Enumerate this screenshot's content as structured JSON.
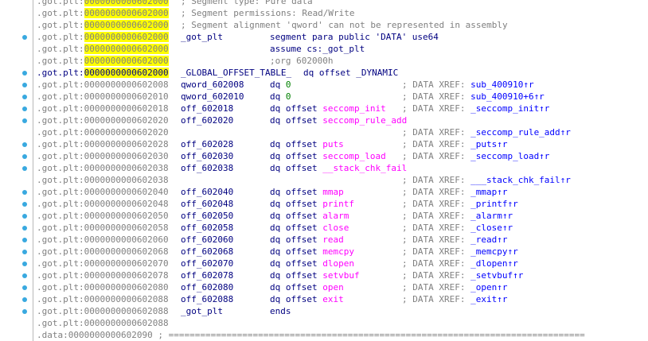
{
  "segments": {
    "got_plt": ".got.plt:",
    "data": ".data:"
  },
  "lines": [
    {
      "addr": "0000000000602000",
      "seg": "got_plt",
      "hl": true,
      "comment": "; Segment type: Pure data"
    },
    {
      "addr": "0000000000602000",
      "seg": "got_plt",
      "hl": true,
      "comment": "; Segment permissions: Read/Write"
    },
    {
      "addr": "0000000000602000",
      "seg": "got_plt",
      "hl": true,
      "comment": "; Segment alignment 'qword' can not be represented in assembly"
    },
    {
      "addr": "0000000000602000",
      "seg": "got_plt",
      "hl": true,
      "label": "_got_plt",
      "op": "segment para public 'DATA' use64"
    },
    {
      "addr": "0000000000602000",
      "seg": "got_plt",
      "hl": true,
      "op": "assume cs:_got_plt"
    },
    {
      "addr": "0000000000602000",
      "seg": "got_plt",
      "hl": true,
      "op": ";org 602000h",
      "op_comment": true
    },
    {
      "addr": "0000000000602000",
      "seg": "got_plt",
      "hl": true,
      "current": true,
      "label": "_GLOBAL_OFFSET_TABLE_",
      "op_inline": "dq offset _DYNAMIC"
    },
    {
      "addr": "0000000000602008",
      "seg": "got_plt",
      "label": "qword_602008",
      "kw": "dq",
      "num": "0",
      "xref_prefix": "; DATA XREF: ",
      "xref": "sub_400910↑r"
    },
    {
      "addr": "0000000000602010",
      "seg": "got_plt",
      "label": "qword_602010",
      "kw": "dq",
      "num": "0",
      "xref_prefix": "; DATA XREF: ",
      "xref": "sub_400910+6↑r"
    },
    {
      "addr": "0000000000602018",
      "seg": "got_plt",
      "label": "off_602018",
      "kw": "dq offset",
      "imp": "seccomp_init",
      "xref_prefix": "; DATA XREF: ",
      "xref": "_seccomp_init↑r"
    },
    {
      "addr": "0000000000602020",
      "seg": "got_plt",
      "label": "off_602020",
      "kw": "dq offset",
      "imp": "seccomp_rule_add"
    },
    {
      "addr": "0000000000602020",
      "seg": "got_plt",
      "xref_prefix": "; DATA XREF: ",
      "xref": "_seccomp_rule_add↑r"
    },
    {
      "addr": "0000000000602028",
      "seg": "got_plt",
      "label": "off_602028",
      "kw": "dq offset",
      "imp": "puts",
      "xref_prefix": "; DATA XREF: ",
      "xref": "_puts↑r"
    },
    {
      "addr": "0000000000602030",
      "seg": "got_plt",
      "label": "off_602030",
      "kw": "dq offset",
      "imp": "seccomp_load",
      "xref_prefix": "; DATA XREF: ",
      "xref": "_seccomp_load↑r"
    },
    {
      "addr": "0000000000602038",
      "seg": "got_plt",
      "label": "off_602038",
      "kw": "dq offset",
      "imp": "__stack_chk_fail"
    },
    {
      "addr": "0000000000602038",
      "seg": "got_plt",
      "xref_prefix": "; DATA XREF: ",
      "xref": "___stack_chk_fail↑r"
    },
    {
      "addr": "0000000000602040",
      "seg": "got_plt",
      "label": "off_602040",
      "kw": "dq offset",
      "imp": "mmap",
      "xref_prefix": "; DATA XREF: ",
      "xref": "_mmap↑r"
    },
    {
      "addr": "0000000000602048",
      "seg": "got_plt",
      "label": "off_602048",
      "kw": "dq offset",
      "imp": "printf",
      "xref_prefix": "; DATA XREF: ",
      "xref": "_printf↑r"
    },
    {
      "addr": "0000000000602050",
      "seg": "got_plt",
      "label": "off_602050",
      "kw": "dq offset",
      "imp": "alarm",
      "xref_prefix": "; DATA XREF: ",
      "xref": "_alarm↑r"
    },
    {
      "addr": "0000000000602058",
      "seg": "got_plt",
      "label": "off_602058",
      "kw": "dq offset",
      "imp": "close",
      "xref_prefix": "; DATA XREF: ",
      "xref": "_close↑r"
    },
    {
      "addr": "0000000000602060",
      "seg": "got_plt",
      "label": "off_602060",
      "kw": "dq offset",
      "imp": "read",
      "xref_prefix": "; DATA XREF: ",
      "xref": "_read↑r"
    },
    {
      "addr": "0000000000602068",
      "seg": "got_plt",
      "label": "off_602068",
      "kw": "dq offset",
      "imp": "memcpy",
      "xref_prefix": "; DATA XREF: ",
      "xref": "_memcpy↑r"
    },
    {
      "addr": "0000000000602070",
      "seg": "got_plt",
      "label": "off_602070",
      "kw": "dq offset",
      "imp": "dlopen",
      "xref_prefix": "; DATA XREF: ",
      "xref": "_dlopen↑r"
    },
    {
      "addr": "0000000000602078",
      "seg": "got_plt",
      "label": "off_602078",
      "kw": "dq offset",
      "imp": "setvbuf",
      "xref_prefix": "; DATA XREF: ",
      "xref": "_setvbuf↑r"
    },
    {
      "addr": "0000000000602080",
      "seg": "got_plt",
      "label": "off_602080",
      "kw": "dq offset",
      "imp": "open",
      "xref_prefix": "; DATA XREF: ",
      "xref": "_open↑r"
    },
    {
      "addr": "0000000000602088",
      "seg": "got_plt",
      "label": "off_602088",
      "kw": "dq offset",
      "imp": "exit",
      "xref_prefix": "; DATA XREF: ",
      "xref": "_exit↑r"
    },
    {
      "addr": "0000000000602088",
      "seg": "got_plt",
      "label": "_got_plt",
      "op": "ends"
    },
    {
      "addr": "0000000000602088",
      "seg": "got_plt"
    },
    {
      "addr": "0000000000602090",
      "seg": "data",
      "sep": " ; ==============================================================================="
    }
  ],
  "colors": {
    "address_highlight": "#ffff00",
    "gutter_dot": "#39a9e0",
    "imported_name": "#ff00ff",
    "number": "#008000",
    "comment": "#808080",
    "code": "#000080"
  }
}
